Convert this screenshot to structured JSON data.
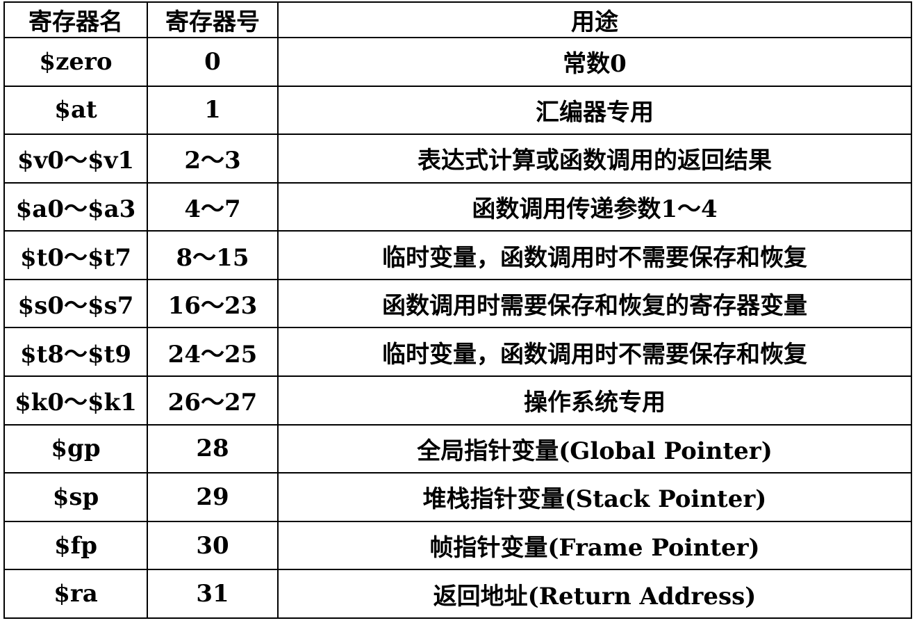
{
  "header": {
    "name": "寄存器名",
    "number": "寄存器号",
    "usage": "用途"
  },
  "rows": [
    {
      "name": "$zero",
      "number": "0",
      "usage": "常数0"
    },
    {
      "name": "$at",
      "number": "1",
      "usage": "汇编器专用"
    },
    {
      "name": "$v0～$v1",
      "number": "2～3",
      "usage": "表达式计算或函数调用的返回结果"
    },
    {
      "name": "$a0～$a3",
      "number": "4～7",
      "usage": "函数调用传递参数1～4"
    },
    {
      "name": "$t0～$t7",
      "number": "8～15",
      "usage": "临时变量，函数调用时不需要保存和恢复"
    },
    {
      "name": "$s0～$s7",
      "number": "16～23",
      "usage": "函数调用时需要保存和恢复的寄存器变量"
    },
    {
      "name": "$t8～$t9",
      "number": "24～25",
      "usage": "临时变量，函数调用时不需要保存和恢复"
    },
    {
      "name": "$k0～$k1",
      "number": "26～27",
      "usage": "操作系统专用"
    },
    {
      "name": "$gp",
      "number": "28",
      "usage": "全局指针变量(Global Pointer)"
    },
    {
      "name": "$sp",
      "number": "29",
      "usage": "堆栈指针变量(Stack Pointer)"
    },
    {
      "name": "$fp",
      "number": "30",
      "usage": "帧指针变量(Frame Pointer)"
    },
    {
      "name": "$ra",
      "number": "31",
      "usage": "返回地址(Return Address)"
    }
  ]
}
